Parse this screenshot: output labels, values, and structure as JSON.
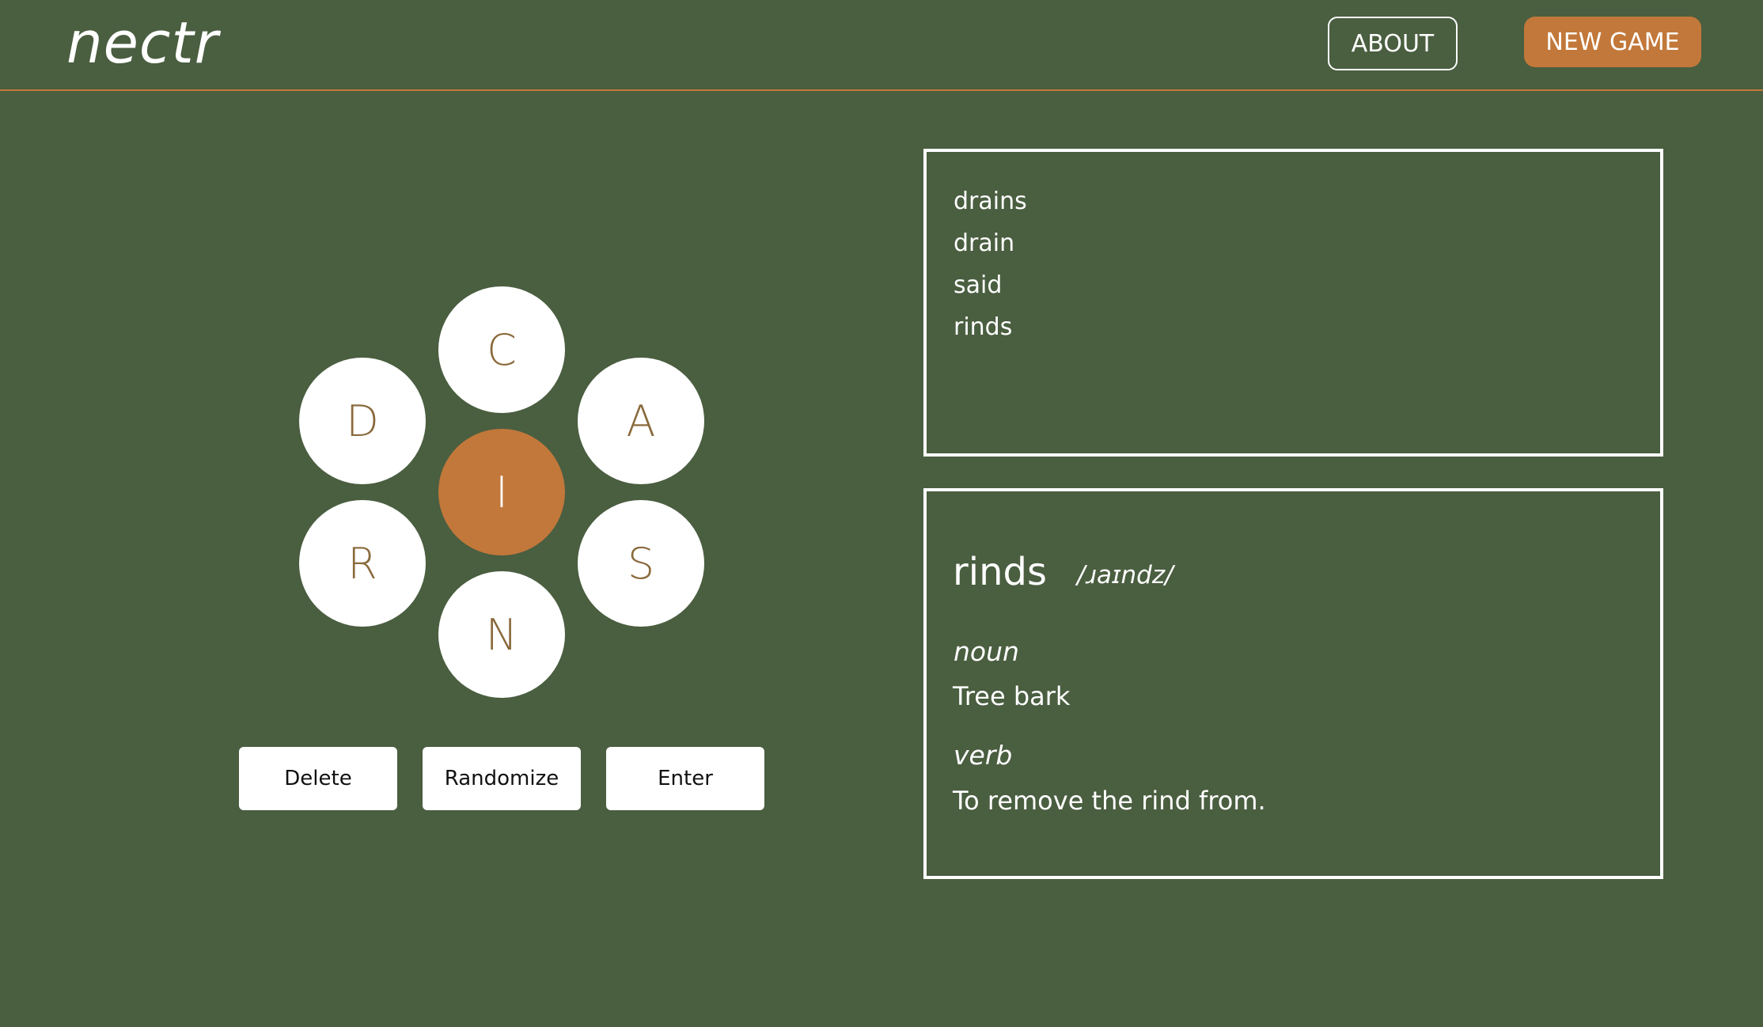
{
  "header": {
    "logo": "nectr",
    "about_label": "ABOUT",
    "new_game_label": "NEW GAME"
  },
  "hive": {
    "center_letter": "I",
    "outer_letters": {
      "top": "C",
      "upper_left": "D",
      "upper_right": "A",
      "lower_left": "R",
      "lower_right": "S",
      "bottom": "N"
    }
  },
  "controls": {
    "delete_label": "Delete",
    "randomize_label": "Randomize",
    "enter_label": "Enter"
  },
  "found_words": [
    "drains",
    "drain",
    "said",
    "rinds"
  ],
  "definition": {
    "word": "rinds",
    "pronunciation": "/ɹaɪndz/",
    "senses": [
      {
        "part_of_speech": "noun",
        "meaning": "Tree bark"
      },
      {
        "part_of_speech": "verb",
        "meaning": "To remove the rind from."
      }
    ]
  },
  "colors": {
    "background": "#4a5e40",
    "accent": "#c2783a",
    "letter": "#8a6a3c",
    "panel_border": "#ffffff"
  }
}
